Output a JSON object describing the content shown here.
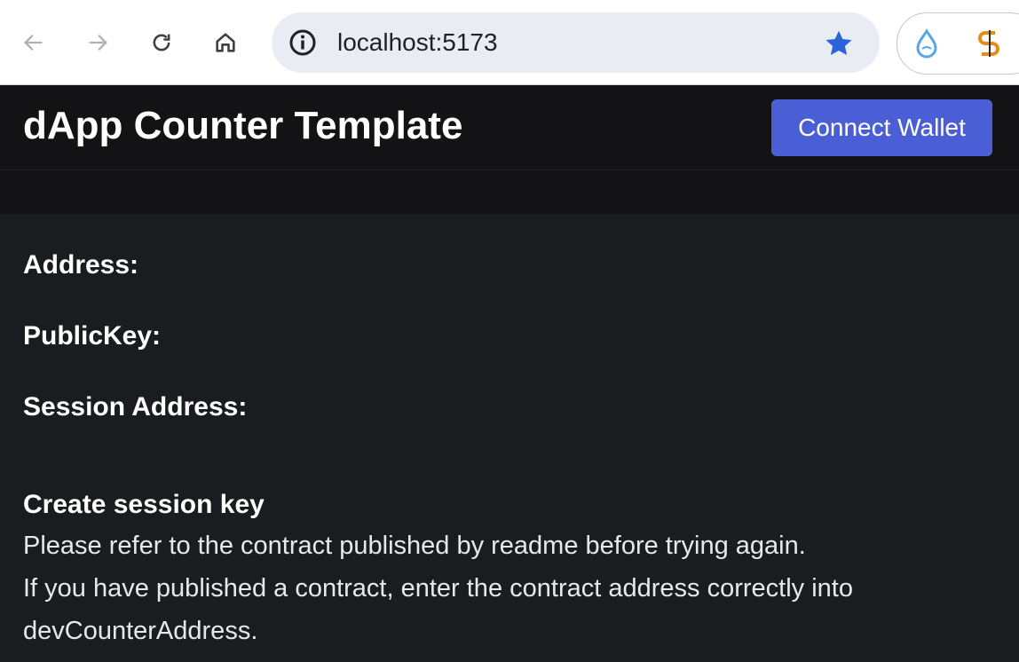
{
  "browser": {
    "url": "localhost:5173",
    "nav_icons": [
      "back-arrow-icon",
      "forward-arrow-icon",
      "reload-icon",
      "home-icon"
    ],
    "extensions": [
      "sui-wallet-icon",
      "surf-wallet-icon"
    ],
    "accent_color": "#2b63d9"
  },
  "app": {
    "title": "dApp Counter Template",
    "connect_label": "Connect Wallet",
    "brand_color": "#4a5fd6"
  },
  "fields": {
    "address_label": "Address:",
    "address_value": "",
    "publickey_label": "PublicKey:",
    "publickey_value": "",
    "session_address_label": "Session Address:",
    "session_address_value": ""
  },
  "session": {
    "heading": "Create session key",
    "line1": "Please refer to the contract published by readme before trying again.",
    "line2": "If you have published a contract, enter the contract address correctly into devCounterAddress."
  }
}
